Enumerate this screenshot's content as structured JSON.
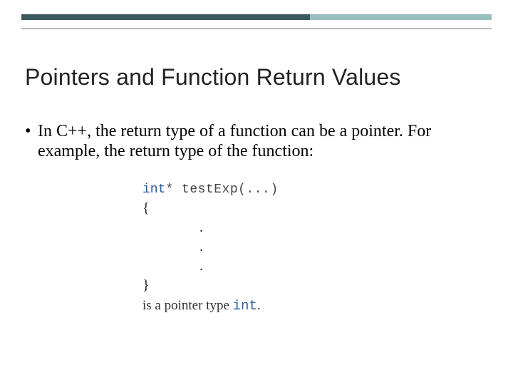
{
  "title": "Pointers and Function Return Values",
  "bullet": {
    "marker": "•",
    "text": "In C++, the return type of a function can be a pointer. For example, the return type of the function:"
  },
  "code": {
    "ret_kw": "int",
    "star": "*",
    "sig": " testExp(...)",
    "open": "{",
    "dot": ".",
    "close": "}"
  },
  "footline": {
    "prefix": "is a pointer type ",
    "kw": "int",
    "suffix": "."
  },
  "colors": {
    "bar_dark": "#3a5a5f",
    "bar_light": "#9abfbf",
    "keyword": "#2a5aa0"
  }
}
